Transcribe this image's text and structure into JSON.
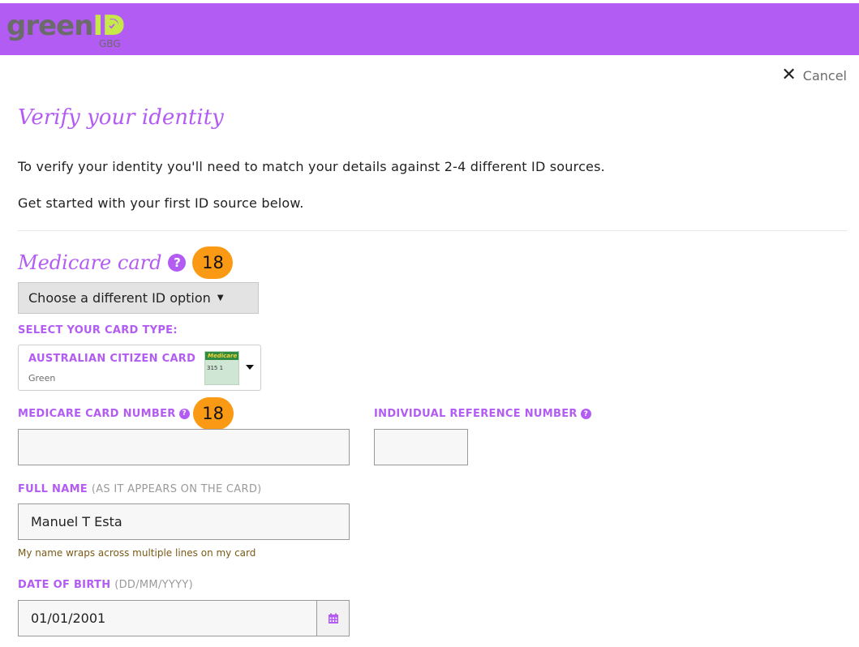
{
  "brand": {
    "name_part1": "green",
    "name_part2": "ID",
    "sub": "GBG",
    "accent": "#b35cf4",
    "logo_green": "#c6e84a"
  },
  "header": {
    "cancel_label": "Cancel",
    "cancel_icon": "close-icon"
  },
  "page": {
    "title": "Verify your identity",
    "intro_line1": "To verify your identity you'll need to match your details against 2-4 different ID sources.",
    "intro_line2": "Get started with your first ID source below."
  },
  "section": {
    "title": "Medicare card",
    "badge": "18",
    "choose_button": "Choose a different ID option"
  },
  "card_type": {
    "label": "SELECT YOUR CARD TYPE:",
    "selected_name": "AUSTRALIAN CITIZEN CARD",
    "selected_color": "Green",
    "thumb_title": "Medicare",
    "thumb_number": "315 1"
  },
  "fields": {
    "medicare_number": {
      "label": "MEDICARE CARD NUMBER",
      "badge": "18",
      "value": ""
    },
    "irn": {
      "label": "INDIVIDUAL REFERENCE NUMBER",
      "value": ""
    },
    "full_name": {
      "label": "FULL NAME",
      "hint": "(AS IT APPEARS ON THE CARD)",
      "value": "Manuel T Esta",
      "helper": "My name wraps across multiple lines on my card"
    },
    "dob": {
      "label": "DATE OF BIRTH",
      "hint": "(DD/MM/YYYY)",
      "value": "01/01/2001"
    }
  }
}
